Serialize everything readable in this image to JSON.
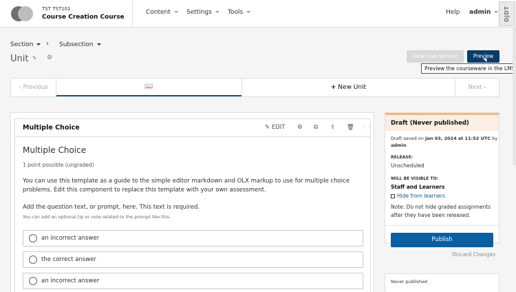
{
  "header": {
    "course_org": "TST TST101",
    "course_title": "Course Creation Course",
    "nav": {
      "content": "Content",
      "settings": "Settings",
      "tools": "Tools"
    },
    "help": "Help",
    "user": "admin",
    "ddt": "DjDT"
  },
  "breadcrumb": {
    "section": "Section",
    "subsection": "Subsection",
    "sep": "›"
  },
  "unit": {
    "title": "Unit",
    "pencil_icon": "pencil-icon",
    "gear_icon": "gear-icon"
  },
  "actions": {
    "view_live": "View Live Version",
    "preview": "Preview",
    "tooltip": "Preview the courseware in the LMS"
  },
  "sequence": {
    "previous": "Previous",
    "new_unit": "New Unit",
    "next": "Next",
    "tab_icon": "book-icon"
  },
  "component": {
    "header_title": "Multiple Choice",
    "edit_label": "EDIT",
    "problem_title": "Multiple Choice",
    "points": "1 point possible (ungraded)",
    "description": "You can use this template as a guide to the simple editor markdown and OLX markup to use for multiple choice problems. Edit this component to replace this template with your own assessment.",
    "question": "Add the question text, or prompt, here. This text is required.",
    "tip": "You can add an optional tip or note related to the prompt like this.",
    "choices": [
      "an incorrect answer",
      "the correct answer",
      "an incorrect answer"
    ]
  },
  "sidebar": {
    "status_title": "Draft (Never published)",
    "saved_prefix": "Draft saved on ",
    "saved_date": "Jan 03, 2024 at 11:52 UTC",
    "saved_by": " by",
    "saved_user": "admin",
    "release_label": "RELEASE:",
    "release_value": "Unscheduled",
    "visible_label": "WILL BE VISIBLE TO:",
    "visible_value": "Staff and Learners",
    "hide_label": "Hide from learners",
    "note": "Note: Do not hide graded assignments after they have been released.",
    "publish": "Publish",
    "discard": "Discard Changes",
    "never_published": "Never published"
  },
  "colors": {
    "preview_button": "#0a3c65",
    "publish_button": "#0a5fa0",
    "draft_accent": "#f8b57b",
    "draft_bg": "#fbeee2",
    "link": "#0a5a8e"
  }
}
